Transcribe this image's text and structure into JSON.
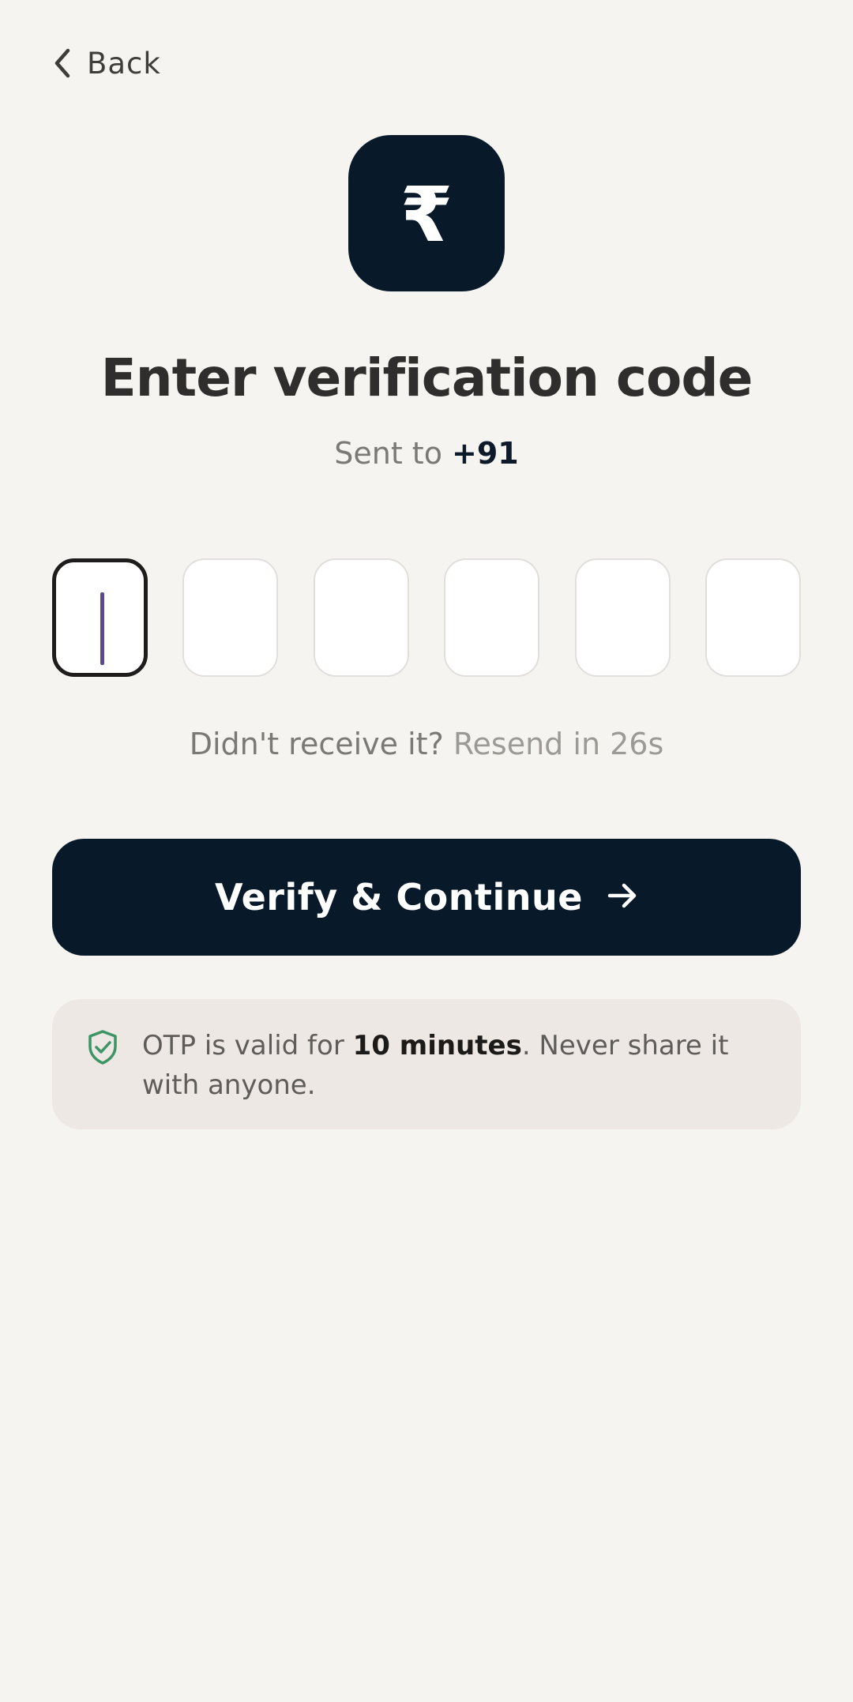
{
  "header": {
    "back_label": "Back"
  },
  "logo": {
    "glyph": "₹",
    "background": "#08192a"
  },
  "title": "Enter verification code",
  "subtitle": {
    "prefix": "Sent to ",
    "phone": "+91"
  },
  "otp": {
    "length": 6,
    "values": [
      "",
      "",
      "",
      "",
      "",
      ""
    ],
    "active_index": 0
  },
  "resend": {
    "prompt": "Didn't receive it? ",
    "countdown": "Resend in 26s"
  },
  "verify_button": {
    "label": "Verify & Continue",
    "icon": "arrow-right-icon"
  },
  "notice": {
    "icon": "shield-check-icon",
    "text_before": "OTP is valid for ",
    "text_strong": "10 minutes",
    "text_after": ". Never share it with anyone."
  },
  "colors": {
    "page_background": "#f5f4f1",
    "primary": "#08192a",
    "shield_green": "#3d9466",
    "caret": "#5b4a8e",
    "notice_background": "#ede8e3"
  }
}
